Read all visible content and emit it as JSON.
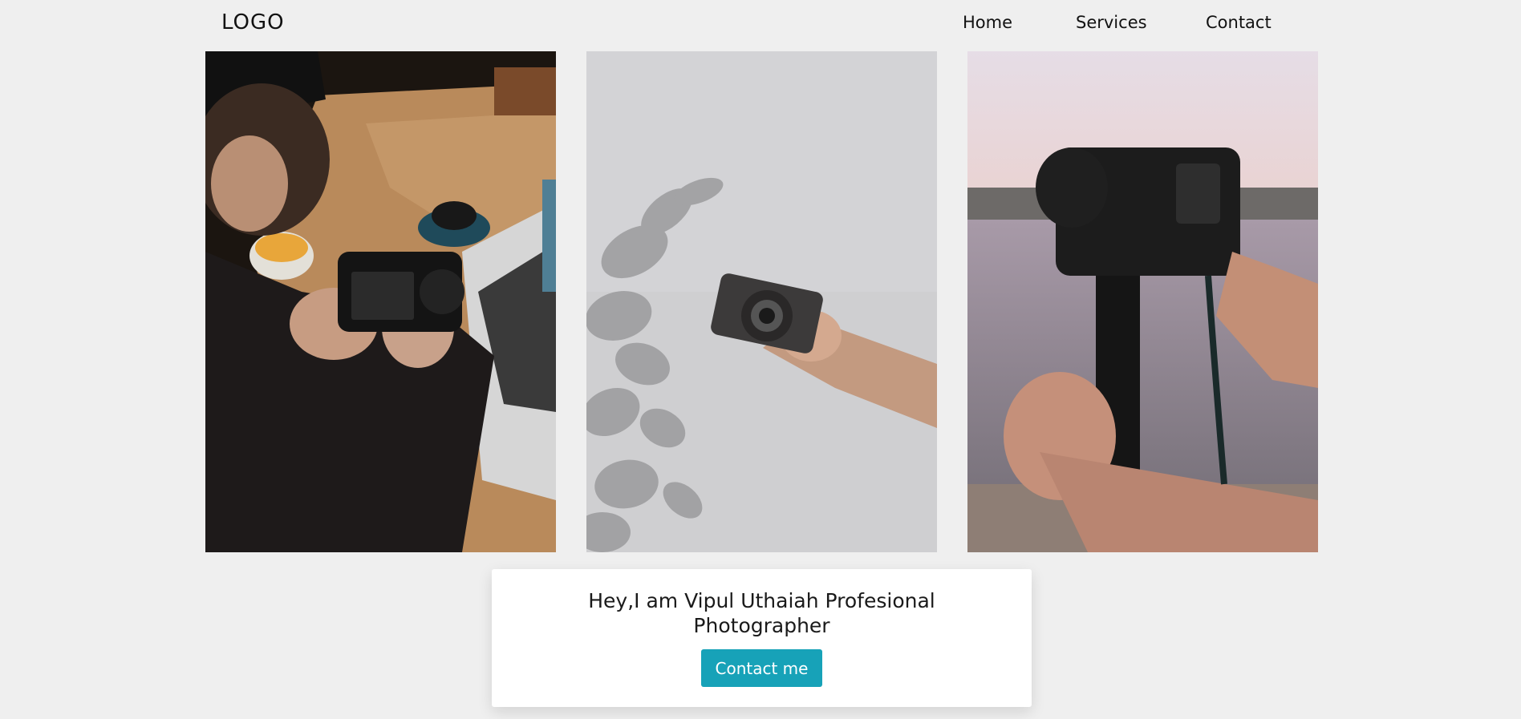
{
  "header": {
    "logo": "LOGO",
    "nav": {
      "home": "Home",
      "services": "Services",
      "contact": "Contact"
    }
  },
  "gallery": {
    "photos": [
      {
        "subject": "man-checking-dslr-camera-at-cafe-table"
      },
      {
        "subject": "hand-holding-vintage-camera-against-grey-wall"
      },
      {
        "subject": "camera-on-monopod-by-the-sea"
      }
    ]
  },
  "intro": {
    "heading": "Hey,I am Vipul Uthaiah Profesional Photographer",
    "button_label": "Contact me"
  },
  "colors": {
    "page_background": "#efefef",
    "accent": "#17a2b8",
    "card_background": "#ffffff"
  }
}
